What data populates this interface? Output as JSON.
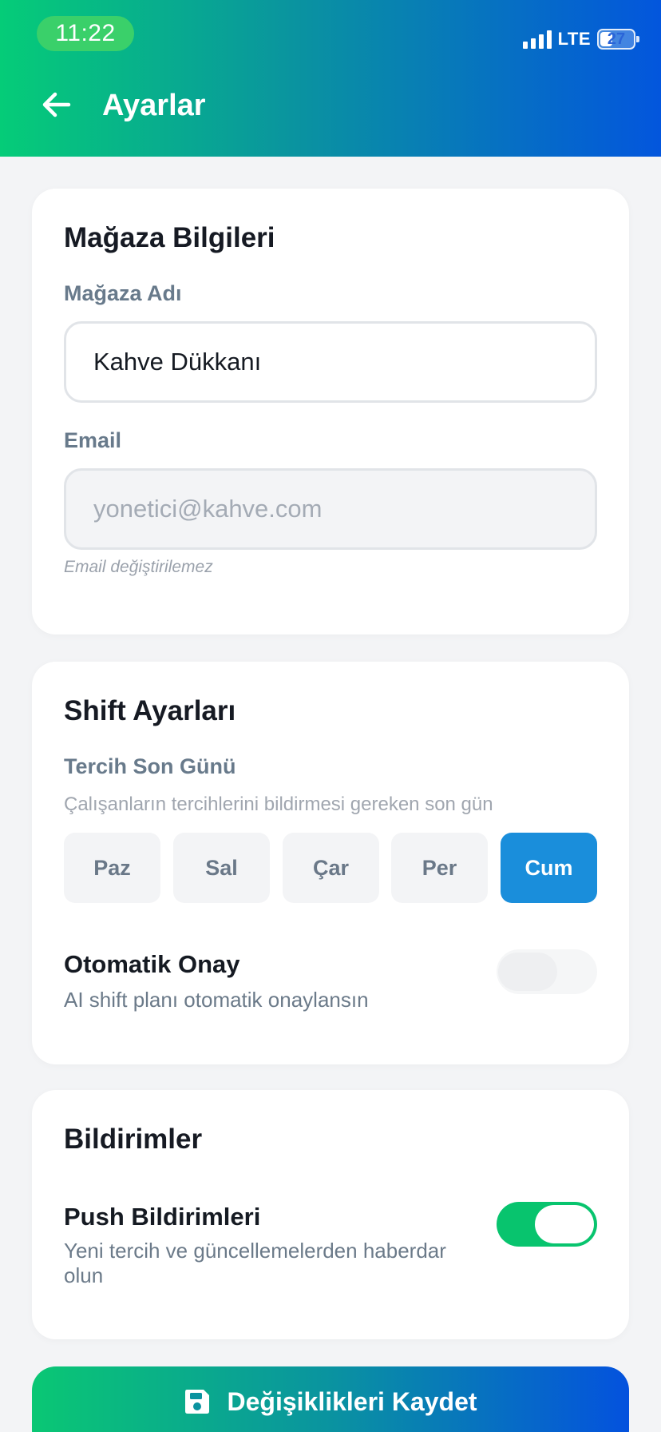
{
  "status_bar": {
    "time": "11:22",
    "network": "LTE",
    "battery": "27"
  },
  "header": {
    "back_icon": "arrow-left-icon",
    "title": "Ayarlar"
  },
  "store_info": {
    "title": "Mağaza Bilgileri",
    "name_label": "Mağaza Adı",
    "name_value": "Kahve Dükkanı",
    "email_label": "Email",
    "email_value": "yonetici@kahve.com",
    "email_hint": "Email değiştirilemez"
  },
  "shift_settings": {
    "title": "Shift Ayarları",
    "deadline_label": "Tercih Son Günü",
    "deadline_desc": "Çalışanların tercihlerini bildirmesi gereken son gün",
    "days": [
      "Paz",
      "Sal",
      "Çar",
      "Per",
      "Cum"
    ],
    "selected_day": "Cum",
    "auto_approve_title": "Otomatik Onay",
    "auto_approve_desc": "AI shift planı otomatik onaylansın",
    "auto_approve_on": false
  },
  "notifications": {
    "title": "Bildirimler",
    "push_title": "Push Bildirimleri",
    "push_desc": "Yeni tercih ve güncellemelerden haberdar olun",
    "push_on": true
  },
  "actions": {
    "save_icon": "floppy-disk-icon",
    "save_label": "Değişiklikleri Kaydet"
  },
  "colors": {
    "header_gradient_start": "#05cc78",
    "header_gradient_end": "#0356dd",
    "accent_blue": "#1a8edb",
    "toggle_on": "#08c46e"
  }
}
